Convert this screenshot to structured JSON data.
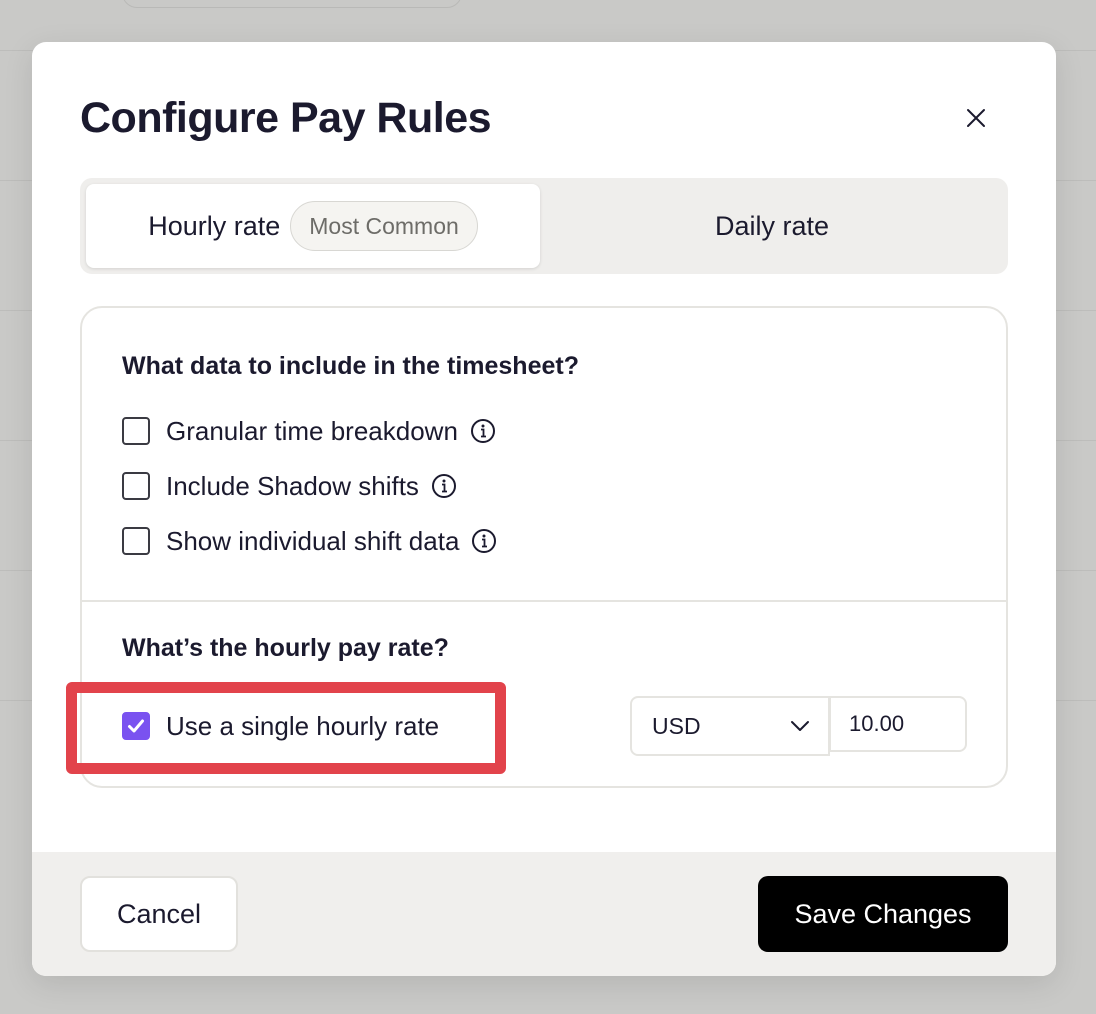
{
  "modal": {
    "title": "Configure Pay Rules"
  },
  "tabs": {
    "hourly": {
      "label": "Hourly rate",
      "badge": "Most Common",
      "active": true
    },
    "daily": {
      "label": "Daily rate",
      "active": false
    }
  },
  "timesheet": {
    "title": "What data to include in the timesheet?",
    "options": [
      {
        "label": "Granular time breakdown",
        "checked": false,
        "icon": "info-icon"
      },
      {
        "label": "Include Shadow shifts",
        "checked": false,
        "icon": "info-icon"
      },
      {
        "label": "Show individual shift data",
        "checked": false,
        "icon": "info-icon"
      }
    ]
  },
  "pay_rate": {
    "title": "What’s the hourly pay rate?",
    "single_rate_label": "Use a single hourly rate",
    "single_rate_checked": true,
    "currency": "USD",
    "rate_value": "10.00"
  },
  "footer": {
    "cancel_label": "Cancel",
    "save_label": "Save Changes"
  },
  "colors": {
    "accent": "#7a52f0",
    "highlight": "#e2434b",
    "primary_button": "#000000"
  }
}
